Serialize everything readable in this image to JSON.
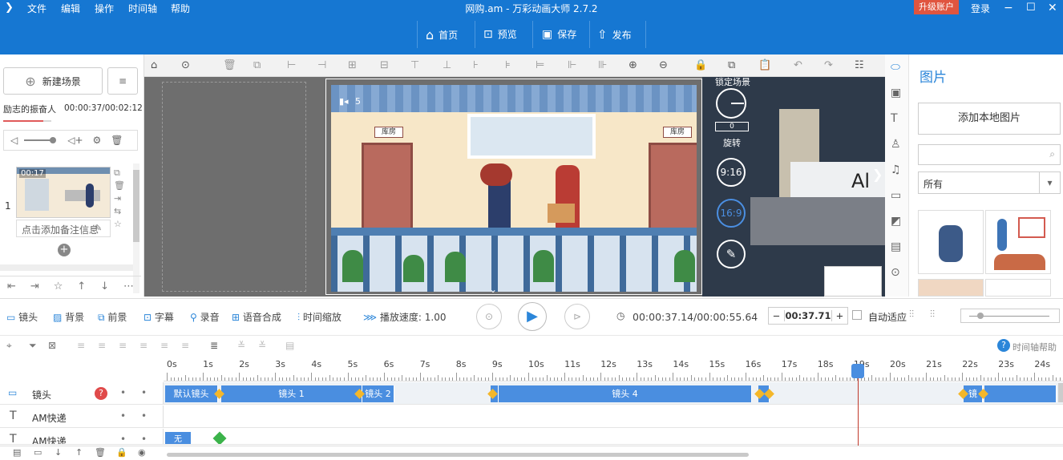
{
  "menu": [
    "文件",
    "编辑",
    "操作",
    "时间轴",
    "帮助"
  ],
  "window_title": "网购.am - 万彩动画大师 2.7.2",
  "header_right": {
    "upgrade": "升级账户",
    "login": "登录"
  },
  "nav": [
    {
      "label": "首页",
      "icon": "home-icon"
    },
    {
      "label": "预览",
      "icon": "preview-icon"
    },
    {
      "label": "保存",
      "icon": "save-icon"
    },
    {
      "label": "发布",
      "icon": "publish-icon"
    }
  ],
  "left": {
    "new_scene": "新建场景",
    "audio_name": "励志的振奋人",
    "audio_time": "00:00:37/00:02:12",
    "scene_number": "1",
    "scene_duration": "00:17",
    "note_placeholder": "点击添加备注信息"
  },
  "canvas": {
    "cam_label": "5",
    "lock_scene": "锁定场景",
    "rotate_value": "0",
    "rotate_label": "旋转",
    "ratio_916": "9:16",
    "ratio_169": "16:9",
    "sign_storage": "库房",
    "preview_text": "Al"
  },
  "right": {
    "title": "图片",
    "add_local": "添加本地图片",
    "search_placeholder": "",
    "category": "所有"
  },
  "controls": {
    "tabs": [
      "镜头",
      "背景",
      "前景",
      "字幕",
      "录音",
      "语音合成",
      "时间缩放",
      "播放速度: 1.00"
    ],
    "time": "00:00:37.14/00:00:55.64",
    "jump_time": "00:37.71",
    "auto_fit": "自动适应"
  },
  "timeline": {
    "help": "时间轴帮助",
    "ticks": [
      "0s",
      "1s",
      "2s",
      "3s",
      "4s",
      "5s",
      "6s",
      "7s",
      "8s",
      "9s",
      "10s",
      "11s",
      "12s",
      "13s",
      "14s",
      "15s",
      "16s",
      "17s",
      "18s",
      "19s",
      "20s",
      "21s",
      "22s",
      "23s",
      "24s"
    ],
    "tracks": [
      {
        "name": "镜头",
        "icon": "camera-icon"
      },
      {
        "name": "AM快递",
        "icon": "text-icon"
      },
      {
        "name": "AM快递",
        "icon": "text-icon"
      }
    ],
    "camera_segments": [
      "默认镜头",
      "镜头 1",
      "镜头 2",
      "镜头 4",
      "镜"
    ],
    "text_segment": "无"
  },
  "colors": {
    "primary": "#1677d2",
    "segment": "#4a8ee0",
    "keyframe": "#f4b72a",
    "playhead": "#c0392b"
  }
}
